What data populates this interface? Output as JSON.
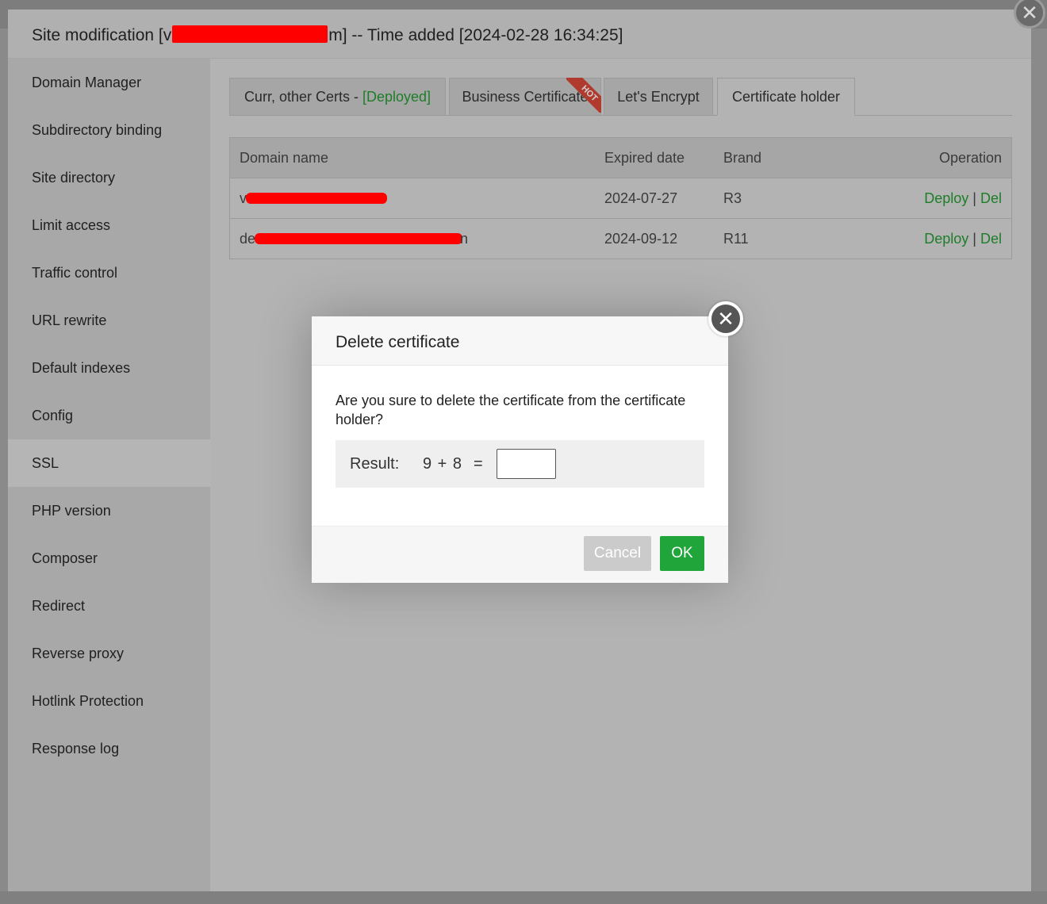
{
  "site_dialog": {
    "title_prefix": "Site modification [v",
    "title_suffix": "m] -- Time added [2024-02-28 16:34:25]",
    "close_glyph": "✕"
  },
  "sidebar": {
    "items": [
      {
        "label": "Domain Manager"
      },
      {
        "label": "Subdirectory binding"
      },
      {
        "label": "Site directory"
      },
      {
        "label": "Limit access"
      },
      {
        "label": "Traffic control"
      },
      {
        "label": "URL rewrite"
      },
      {
        "label": "Default indexes"
      },
      {
        "label": "Config"
      },
      {
        "label": "SSL"
      },
      {
        "label": "PHP version"
      },
      {
        "label": "Composer"
      },
      {
        "label": "Redirect"
      },
      {
        "label": "Reverse proxy"
      },
      {
        "label": "Hotlink Protection"
      },
      {
        "label": "Response log"
      }
    ],
    "active": "SSL"
  },
  "tabs": {
    "curr_label": "Curr, other Certs - ",
    "curr_status": "[Deployed]",
    "business": "Business Certificate",
    "hot_badge": "HOT",
    "letsencrypt": "Let's Encrypt",
    "holder": "Certificate holder"
  },
  "table": {
    "headers": {
      "domain": "Domain name",
      "expired": "Expired date",
      "brand": "Brand",
      "operation": "Operation"
    },
    "rows": [
      {
        "domain_prefix": "v",
        "domain_suffix": "",
        "expired": "2024-07-27",
        "brand": "R3",
        "deploy": "Deploy",
        "sep": "|",
        "del": "Del"
      },
      {
        "domain_prefix": "de",
        "domain_suffix": "n",
        "expired": "2024-09-12",
        "brand": "R11",
        "deploy": "Deploy",
        "sep": "|",
        "del": "Del"
      }
    ]
  },
  "modal": {
    "title": "Delete certificate",
    "message": "Are you sure to delete the certificate from the certificate holder?",
    "captcha_label": "Result:",
    "captcha_expr": "9 + 8",
    "captcha_eq": "=",
    "captcha_value": "",
    "cancel": "Cancel",
    "ok": "OK",
    "close_glyph": "✕"
  },
  "colors": {
    "accent_green": "#20a53a",
    "redaction": "#ff0000"
  }
}
